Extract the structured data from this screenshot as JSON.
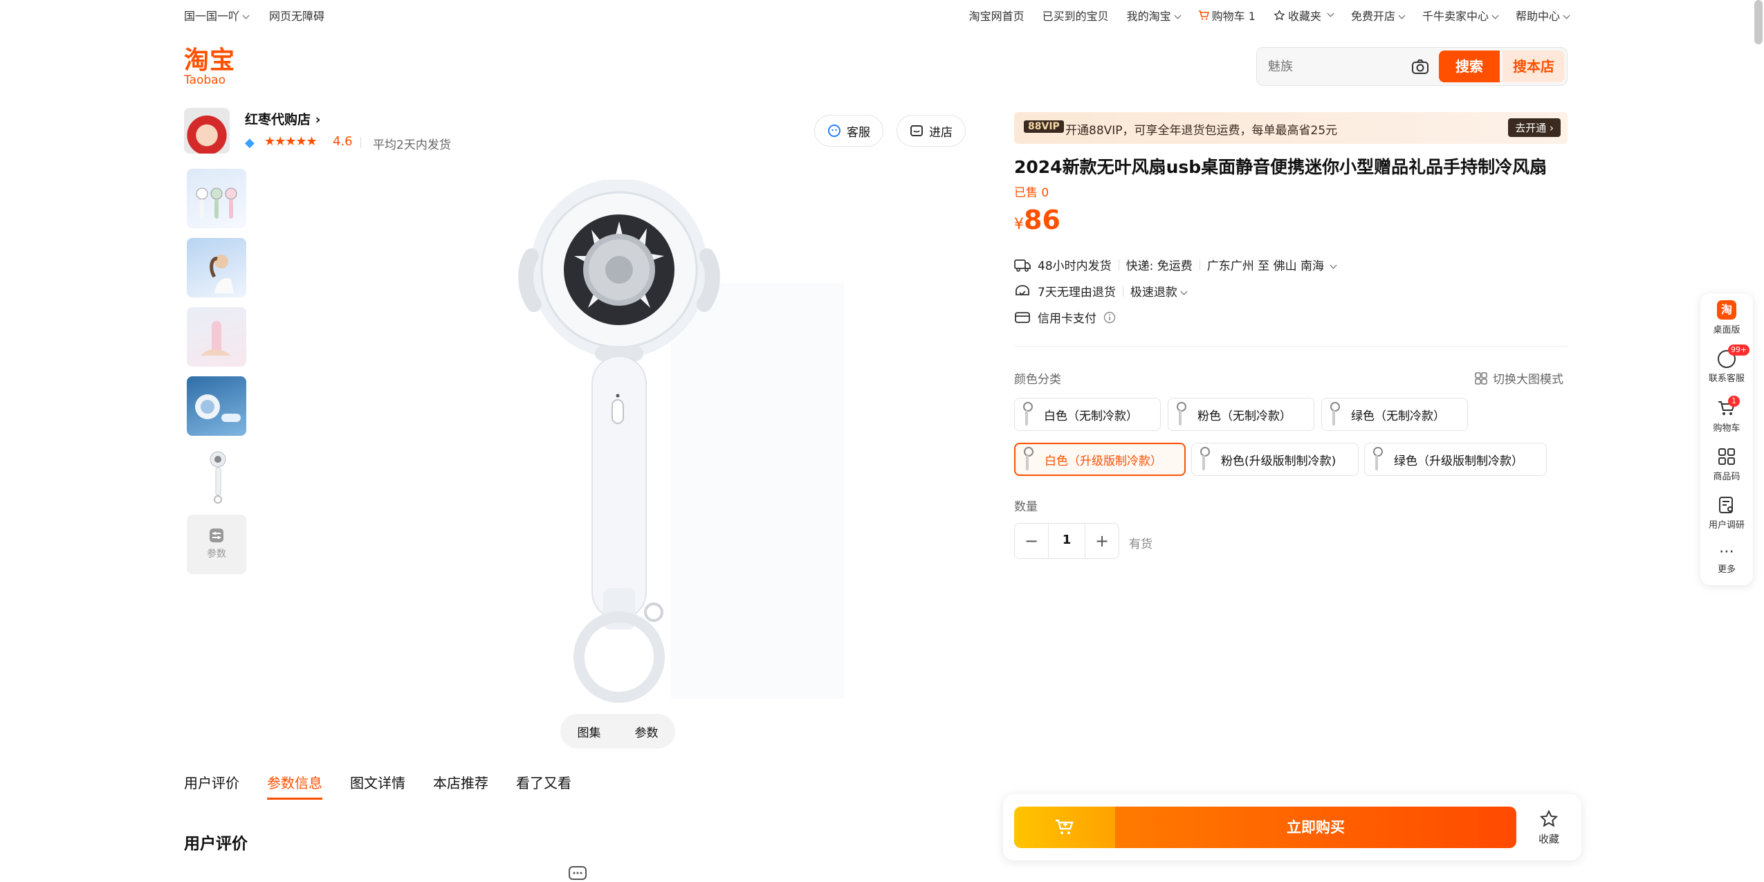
{
  "topbar": {
    "region": "国一国一吖",
    "accessibility": "网页无障碍",
    "home": "淘宝网首页",
    "bought": "已买到的宝贝",
    "my_taobao": "我的淘宝",
    "cart": "购物车 1",
    "favorites": "收藏夹",
    "open_shop": "免费开店",
    "seller_center": "千牛卖家中心",
    "help": "帮助中心"
  },
  "logo": {
    "cn": "淘宝",
    "en": "Taobao"
  },
  "search": {
    "placeholder": "魅族",
    "search_btn": "搜索",
    "search_shop_btn": "搜本店"
  },
  "shop": {
    "name": "红枣代购店",
    "stars": "★★★★★",
    "rating": "4.6",
    "ship_note": "平均2天内发货",
    "service_btn": "客服",
    "enter_btn": "进店"
  },
  "gallery": {
    "params_thumb": "参数",
    "tab_album": "图集",
    "tab_params": "参数"
  },
  "detail_tabs": [
    "用户评价",
    "参数信息",
    "图文详情",
    "本店推荐",
    "看了又看"
  ],
  "section_title": "用户评价",
  "vip": {
    "badge": "88VIP",
    "text": "开通88VIP，可享全年退货包运费，每单最高省25元",
    "go": "去开通"
  },
  "product": {
    "title": "2024新款无叶风扇usb桌面静音便携迷你小型赠品礼品手持制冷风扇",
    "sold": "已售 0",
    "currency": "¥",
    "price": "86"
  },
  "delivery": {
    "time": "48小时内发货",
    "shipping": "快递: 免运费",
    "route": "广东广州 至 佛山 南海",
    "returns": "7天无理由退货",
    "refund": "极速退款",
    "payment": "信用卡支付"
  },
  "sku": {
    "label": "颜色分类",
    "switch": "切换大图模式",
    "options": [
      "白色（无制冷款）",
      "粉色（无制冷款）",
      "绿色（无制冷款）",
      "白色（升级版制冷款）",
      "粉色(升级版制制冷款)",
      "绿色（升级版制制冷款）"
    ],
    "selected_index": 3
  },
  "quantity": {
    "label": "数量",
    "value": "1",
    "stock": "有货"
  },
  "buybar": {
    "buy": "立即购买",
    "fav": "收藏"
  },
  "sidebar": [
    "桌面版",
    "联系客服",
    "购物车",
    "商品码",
    "用户调研",
    "更多"
  ],
  "badges": {
    "service": "99+",
    "cart": "1"
  },
  "colors": {
    "brand": "#ff5000"
  }
}
